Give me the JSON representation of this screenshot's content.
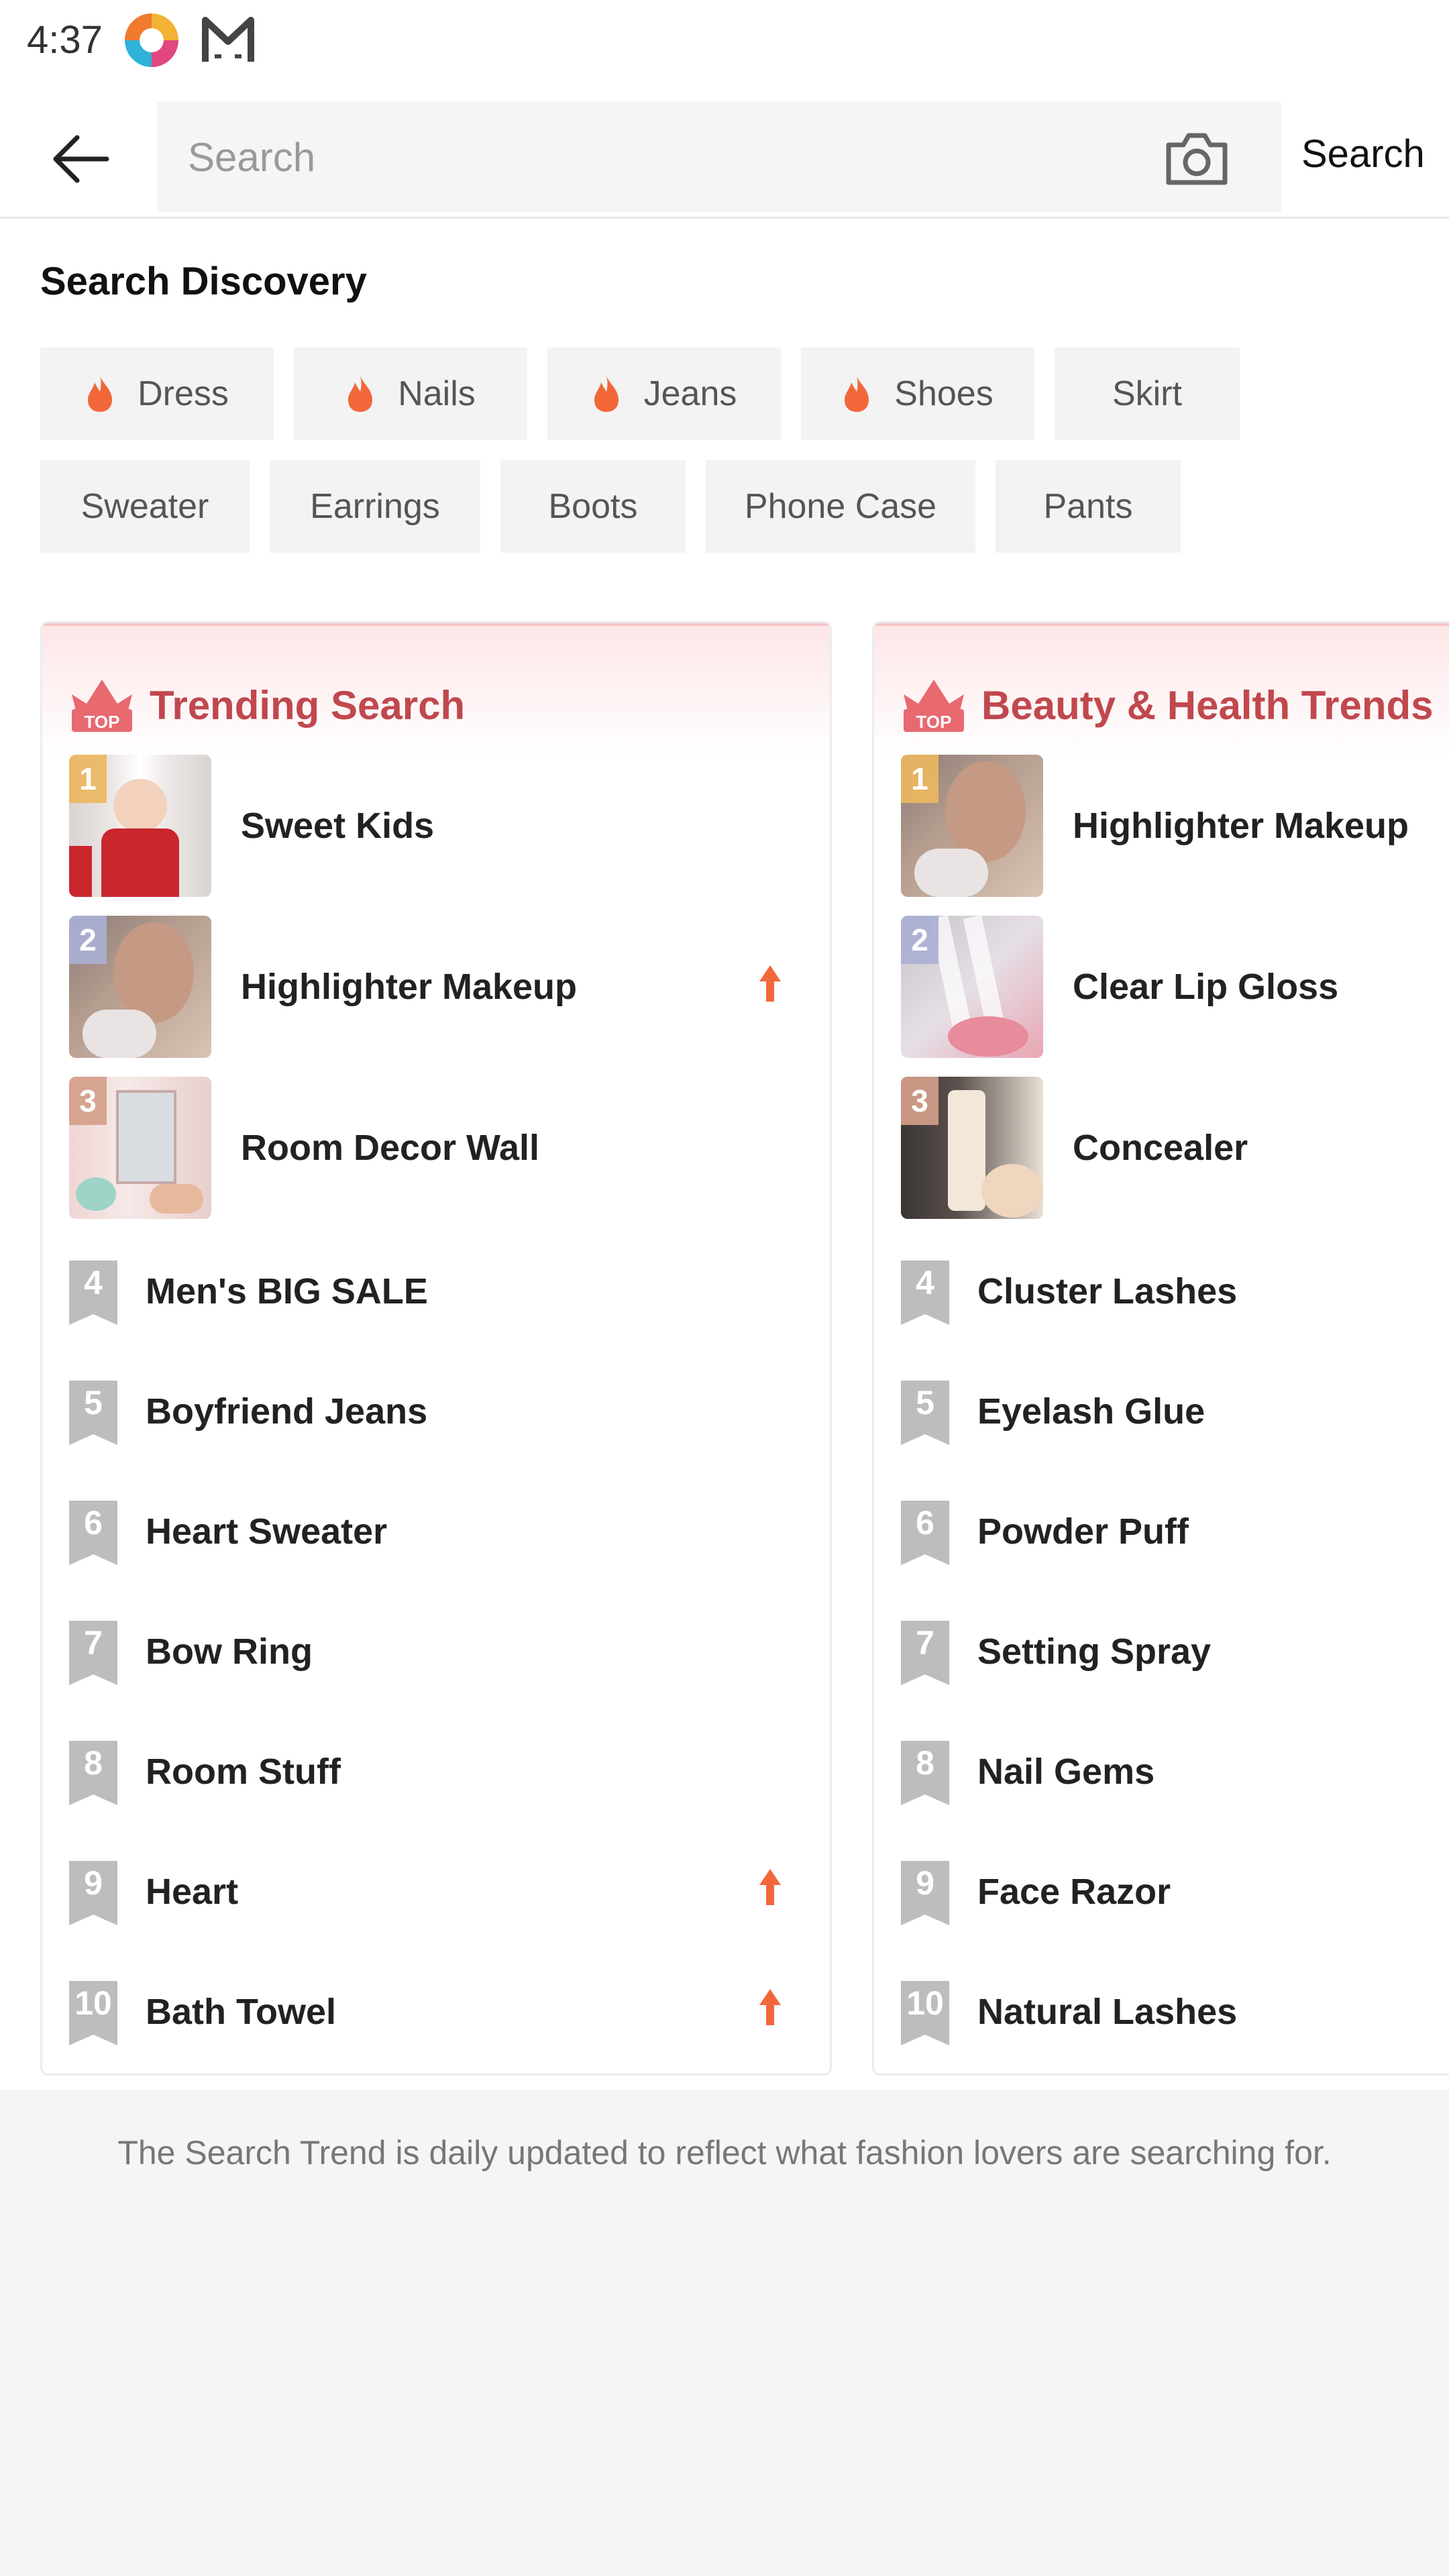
{
  "status_bar": {
    "time": "4:37"
  },
  "header": {
    "search_placeholder": "Search",
    "search_button_label": "Search"
  },
  "discovery": {
    "title": "Search Discovery",
    "chips": [
      {
        "label": "Dress",
        "hot": true
      },
      {
        "label": "Nails",
        "hot": true
      },
      {
        "label": "Jeans",
        "hot": true
      },
      {
        "label": "Shoes",
        "hot": true
      },
      {
        "label": "Skirt",
        "hot": false
      },
      {
        "label": "Sweater",
        "hot": false
      },
      {
        "label": "Earrings",
        "hot": false
      },
      {
        "label": "Boots",
        "hot": false
      },
      {
        "label": "Phone Case",
        "hot": false
      },
      {
        "label": "Pants",
        "hot": false
      }
    ]
  },
  "trending": {
    "title": "Trending Search",
    "badge_text": "TOP",
    "items": [
      {
        "rank": "1",
        "label": "Sweet Kids",
        "rising": false
      },
      {
        "rank": "2",
        "label": "Highlighter Makeup",
        "rising": true
      },
      {
        "rank": "3",
        "label": "Room Decor Wall",
        "rising": false
      },
      {
        "rank": "4",
        "label": "Men's BIG SALE",
        "rising": false
      },
      {
        "rank": "5",
        "label": "Boyfriend Jeans",
        "rising": false
      },
      {
        "rank": "6",
        "label": "Heart Sweater",
        "rising": false
      },
      {
        "rank": "7",
        "label": "Bow Ring",
        "rising": false
      },
      {
        "rank": "8",
        "label": "Room Stuff",
        "rising": false
      },
      {
        "rank": "9",
        "label": "Heart",
        "rising": true
      },
      {
        "rank": "10",
        "label": "Bath Towel",
        "rising": true
      }
    ]
  },
  "beauty": {
    "title": "Beauty & Health Trends",
    "badge_text": "TOP",
    "items": [
      {
        "rank": "1",
        "label": "Highlighter Makeup"
      },
      {
        "rank": "2",
        "label": "Clear Lip Gloss"
      },
      {
        "rank": "3",
        "label": "Concealer"
      },
      {
        "rank": "4",
        "label": "Cluster Lashes"
      },
      {
        "rank": "5",
        "label": "Eyelash Glue"
      },
      {
        "rank": "6",
        "label": "Powder Puff"
      },
      {
        "rank": "7",
        "label": "Setting Spray"
      },
      {
        "rank": "8",
        "label": "Nail Gems"
      },
      {
        "rank": "9",
        "label": "Face Razor"
      },
      {
        "rank": "10",
        "label": "Natural Lashes"
      }
    ]
  },
  "footnote": "The Search Trend is daily updated to reflect what fashion lovers are searching for.",
  "colors": {
    "accent_red": "#c0484e",
    "flame": "#f2673a",
    "rank_gray": "#bdbdbd",
    "chip_bg": "#f3f3f3"
  }
}
